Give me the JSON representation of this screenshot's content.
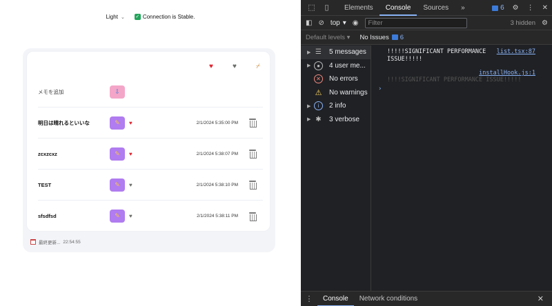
{
  "app": {
    "theme_select": "Light",
    "connection_status": "Connection is Stable.",
    "toolbar": {
      "favorites_icon": "red-heart-icon",
      "nonfavorites_icon": "gray-heart-icon",
      "clear_icon": "broom-icon"
    },
    "add_row": {
      "placeholder": "メモを追加",
      "button_icon": "inbox-tray-icon"
    },
    "memos": [
      {
        "text": "明日は晴れるといいな",
        "favorite": true,
        "date": "2/1/2024 5:35:00 PM"
      },
      {
        "text": "zcxzcxz",
        "favorite": true,
        "date": "2/1/2024 5:38:07 PM"
      },
      {
        "text": "TEST",
        "favorite": false,
        "date": "2/1/2024 5:38:10 PM"
      },
      {
        "text": "sfsdfsd",
        "favorite": false,
        "date": "2/1/2024 5:38:11 PM"
      }
    ],
    "footer": {
      "label": "最終更新...",
      "time": "22:54:55"
    },
    "colors": {
      "edit_button": "#b07cf0",
      "add_button": "#f4a6c8",
      "heart_red": "#e0242f",
      "heart_gray": "#6b6f6a"
    }
  },
  "devtools": {
    "tabs": [
      "Elements",
      "Console",
      "Sources"
    ],
    "active_tab": "Console",
    "issue_badge_count": "6",
    "context": "top",
    "filter_placeholder": "Filter",
    "hidden_count": "3 hidden",
    "default_levels": "Default levels",
    "issues_label": "No Issues",
    "issues_count": "6",
    "sidebar": [
      {
        "label": "5 messages",
        "icon": "list-icon"
      },
      {
        "label": "4 user me...",
        "icon": "user-icon"
      },
      {
        "label": "No errors",
        "icon": "error-icon"
      },
      {
        "label": "No warnings",
        "icon": "warning-icon"
      },
      {
        "label": "2 info",
        "icon": "info-icon"
      },
      {
        "label": "3 verbose",
        "icon": "bug-icon"
      }
    ],
    "console": {
      "msg1_line1": "!!!!!SIGNIFICANT PERFORMANCE",
      "msg1_line2": "ISSUE!!!!!",
      "msg1_source": "list.tsx:87",
      "msg2_source": "installHook.js:1",
      "msg3_text": "!!!!SIGNIFICANT PERFORMANCE ISSUE!!!!!",
      "prompt": "›"
    },
    "drawer_tabs": [
      "Console",
      "Network conditions"
    ]
  }
}
